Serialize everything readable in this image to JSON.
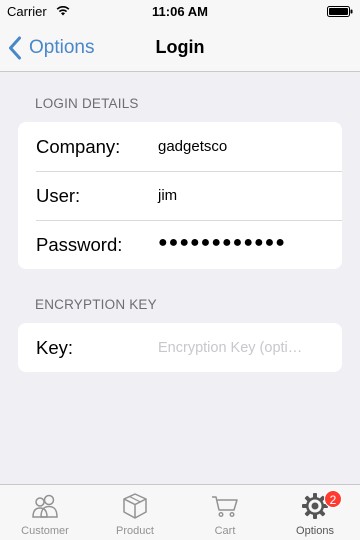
{
  "status_bar": {
    "carrier": "Carrier",
    "time": "11:06 AM"
  },
  "nav": {
    "back_label": "Options",
    "title": "Login"
  },
  "login_details": {
    "header": "LOGIN DETAILS",
    "company": {
      "label": "Company:",
      "value": "gadgetsco"
    },
    "user": {
      "label": "User:",
      "value": "jim"
    },
    "password": {
      "label": "Password:",
      "value": "●●●●●●●●●●●●"
    }
  },
  "encryption": {
    "header": "ENCRYPTION KEY",
    "key": {
      "label": "Key:",
      "value": "",
      "placeholder": "Encryption Key (opti…"
    }
  },
  "tabs": [
    {
      "label": "Customer",
      "icon": "customer-icon"
    },
    {
      "label": "Product",
      "icon": "product-icon"
    },
    {
      "label": "Cart",
      "icon": "cart-icon"
    },
    {
      "label": "Options",
      "icon": "gear-icon",
      "badge": "2"
    }
  ],
  "colors": {
    "accent": "#4a87c9",
    "badge": "#ff3b30",
    "background": "#efeff4"
  }
}
